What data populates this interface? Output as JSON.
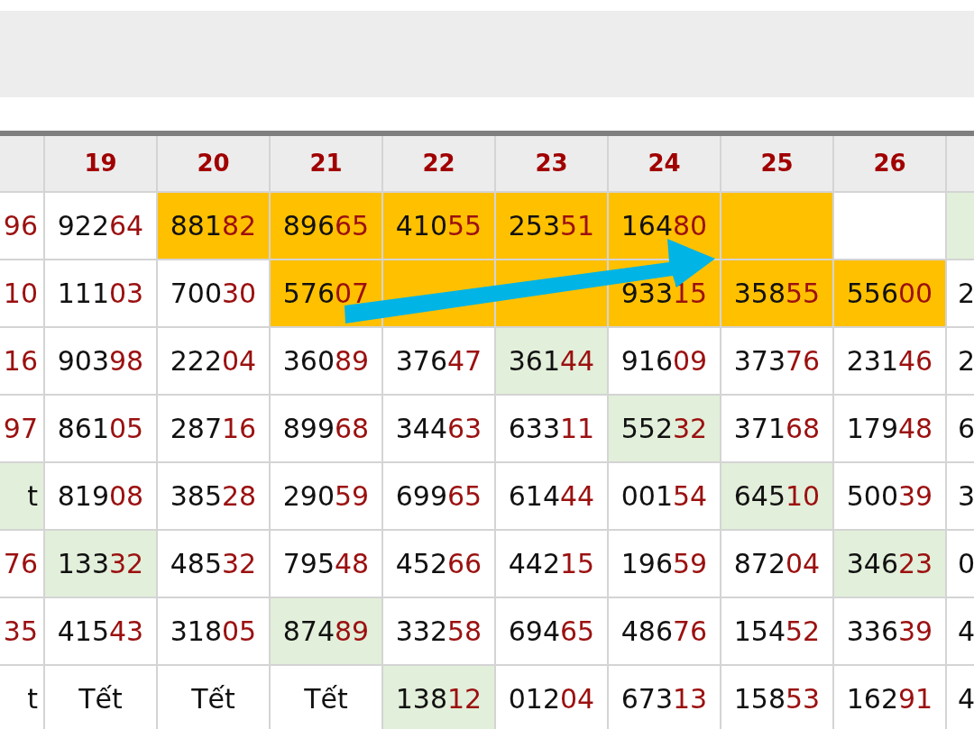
{
  "columns": [
    "19",
    "20",
    "21",
    "22",
    "23",
    "24",
    "25",
    "26"
  ],
  "rows": [
    {
      "cells": [
        {
          "tail": "96"
        },
        {
          "head": "922",
          "tail": "64"
        },
        {
          "head": "881",
          "tail": "82",
          "color": "#ffc000"
        },
        {
          "head": "896",
          "tail": "65",
          "color": "#ffc000"
        },
        {
          "head": "410",
          "tail": "55",
          "color": "#ffc000"
        },
        {
          "head": "253",
          "tail": "51",
          "color": "#ffc000"
        },
        {
          "head": "164",
          "tail": "80",
          "color": "#ffc000"
        },
        {
          "color": "#ffc000"
        },
        {},
        {
          "color": "#e2efda"
        }
      ]
    },
    {
      "cells": [
        {
          "tail": "10"
        },
        {
          "head": "111",
          "tail": "03"
        },
        {
          "head": "700",
          "tail": "30"
        },
        {
          "head": "576",
          "tail": "07",
          "color": "#ffc000"
        },
        {
          "color": "#ffc000"
        },
        {
          "color": "#ffc000"
        },
        {
          "head": "933",
          "tail": "15",
          "color": "#ffc000"
        },
        {
          "head": "358",
          "tail": "55",
          "color": "#ffc000"
        },
        {
          "head": "556",
          "tail": "00",
          "color": "#ffc000"
        },
        {
          "head": "2"
        }
      ]
    },
    {
      "cells": [
        {
          "tail": "16"
        },
        {
          "head": "903",
          "tail": "98"
        },
        {
          "head": "222",
          "tail": "04"
        },
        {
          "head": "360",
          "tail": "89"
        },
        {
          "head": "376",
          "tail": "47"
        },
        {
          "head": "361",
          "tail": "44",
          "color": "#e2efda"
        },
        {
          "head": "916",
          "tail": "09"
        },
        {
          "head": "373",
          "tail": "76"
        },
        {
          "head": "231",
          "tail": "46"
        },
        {
          "head": "2"
        }
      ]
    },
    {
      "cells": [
        {
          "tail": "97"
        },
        {
          "head": "861",
          "tail": "05"
        },
        {
          "head": "287",
          "tail": "16"
        },
        {
          "head": "899",
          "tail": "68"
        },
        {
          "head": "344",
          "tail": "63"
        },
        {
          "head": "633",
          "tail": "11"
        },
        {
          "head": "552",
          "tail": "32",
          "color": "#e2efda"
        },
        {
          "head": "371",
          "tail": "68"
        },
        {
          "head": "179",
          "tail": "48"
        },
        {
          "head": "6"
        }
      ]
    },
    {
      "cells": [
        {
          "head": "t",
          "color": "#e2efda"
        },
        {
          "head": "819",
          "tail": "08"
        },
        {
          "head": "385",
          "tail": "28"
        },
        {
          "head": "290",
          "tail": "59"
        },
        {
          "head": "699",
          "tail": "65"
        },
        {
          "head": "614",
          "tail": "44"
        },
        {
          "head": "001",
          "tail": "54"
        },
        {
          "head": "645",
          "tail": "10",
          "color": "#e2efda"
        },
        {
          "head": "500",
          "tail": "39"
        },
        {
          "head": "3"
        }
      ]
    },
    {
      "cells": [
        {
          "tail": "76"
        },
        {
          "head": "133",
          "tail": "32",
          "color": "#e2efda"
        },
        {
          "head": "485",
          "tail": "32"
        },
        {
          "head": "795",
          "tail": "48"
        },
        {
          "head": "452",
          "tail": "66"
        },
        {
          "head": "442",
          "tail": "15"
        },
        {
          "head": "196",
          "tail": "59"
        },
        {
          "head": "872",
          "tail": "04"
        },
        {
          "head": "346",
          "tail": "23",
          "color": "#e2efda"
        },
        {
          "head": "0"
        }
      ]
    },
    {
      "cells": [
        {
          "tail": "35"
        },
        {
          "head": "415",
          "tail": "43"
        },
        {
          "head": "318",
          "tail": "05"
        },
        {
          "head": "874",
          "tail": "89",
          "color": "#e2efda"
        },
        {
          "head": "332",
          "tail": "58"
        },
        {
          "head": "694",
          "tail": "65"
        },
        {
          "head": "486",
          "tail": "76"
        },
        {
          "head": "154",
          "tail": "52"
        },
        {
          "head": "336",
          "tail": "39"
        },
        {
          "head": "4"
        }
      ]
    },
    {
      "cells": [
        {
          "head": "t"
        },
        {
          "head": "Tết"
        },
        {
          "head": "Tết"
        },
        {
          "head": "Tết"
        },
        {
          "head": "138",
          "tail": "12",
          "color": "#e2efda"
        },
        {
          "head": "012",
          "tail": "04"
        },
        {
          "head": "673",
          "tail": "13"
        },
        {
          "head": "158",
          "tail": "53"
        },
        {
          "head": "162",
          "tail": "91"
        },
        {
          "head": "4"
        }
      ]
    }
  ]
}
